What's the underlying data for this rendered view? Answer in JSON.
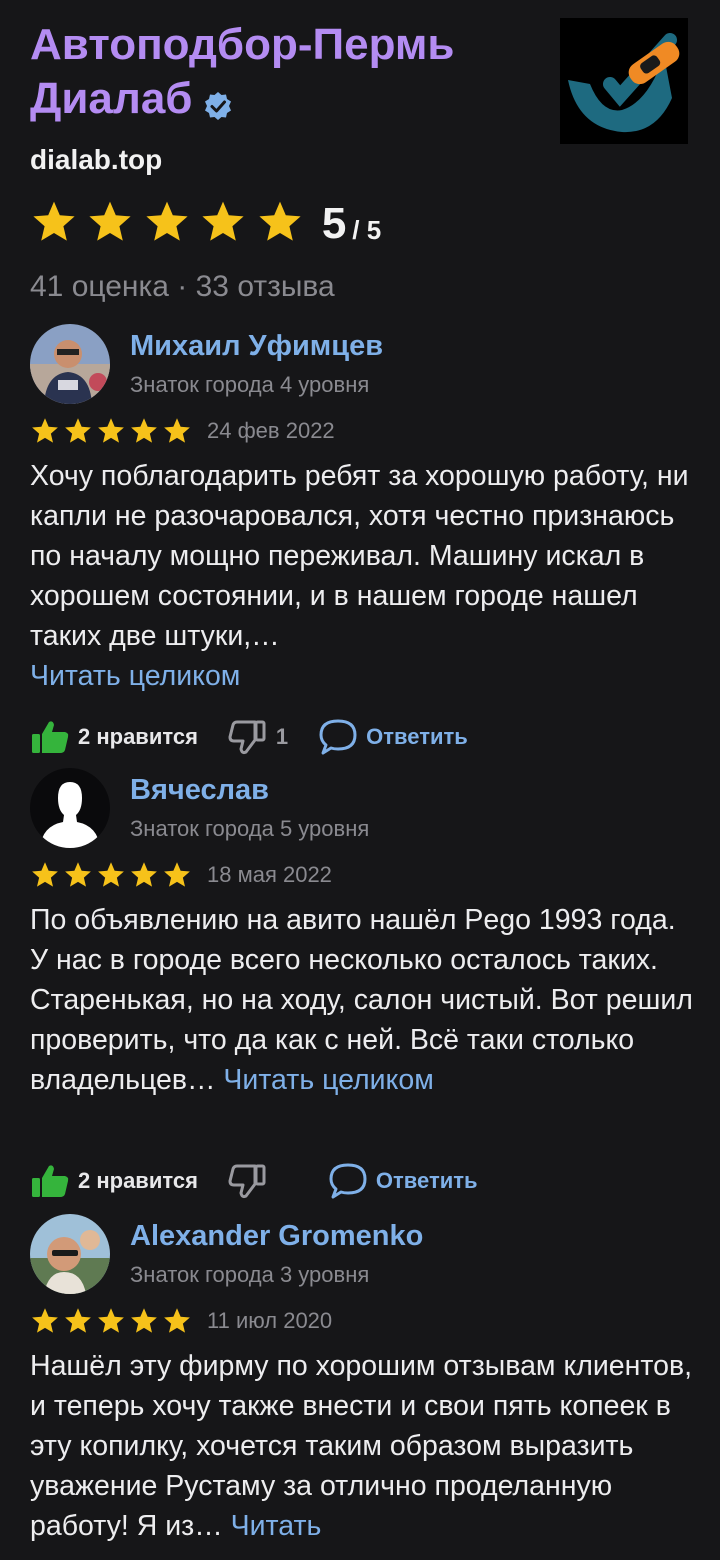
{
  "business": {
    "name_line1": "Автоподбор-Пермь",
    "name_line2": "Диалаб",
    "site": "dialab.top",
    "rating": "5",
    "rating_max": "/ 5",
    "counts": "41 оценка · 33 отзыва",
    "accent_color": "#b48cf2"
  },
  "reviews": [
    {
      "author": "Михаил Уфимцев",
      "level": "Знаток города 4 уровня",
      "stars": 5,
      "date": "24 фев 2022",
      "text": "Хочу поблагодарить ребят за хорошую работу, ни капли не разочаровался, хотя честно признаюсь по началу мощно переживал. Машину искал в хорошем состоянии, и в нашем городе нашел таких две штуки,…",
      "read_more": "Читать целиком",
      "likes": "2 нравится",
      "dislikes": "1",
      "reply": "Ответить"
    },
    {
      "author": "Вячеслав",
      "level": "Знаток города 5 уровня",
      "stars": 5,
      "date": "18 мая 2022",
      "text": "По объявлению на авито нашёл Pego 1993 года. У нас в городе всего несколько осталось таких. Старенькая, но на ходу, салон чистый. Вот решил проверить, что да как с ней. Всё таки столько владельцев…",
      "read_more": "Читать целиком",
      "likes": "2 нравится",
      "dislikes": "",
      "reply": "Ответить"
    },
    {
      "author": "Alexander Gromenko",
      "level": "Знаток города 3 уровня",
      "stars": 5,
      "date": "11 июл 2020",
      "text": "Нашёл эту фирму по хорошим отзывам клиентов, и теперь хочу также внести и свои пять копеек в эту копилку, хочется таким образом выразить уважение Рустаму за отлично проделанную работу! Я из…",
      "read_more": "Читать"
    }
  ],
  "icons": {
    "star": "star-icon",
    "verified": "verified-check-icon",
    "like": "thumbs-up-icon",
    "dislike": "thumbs-down-icon",
    "reply": "speech-bubble-icon"
  },
  "colors": {
    "background": "#161618",
    "star": "#f6c21a",
    "link": "#7fb0e8",
    "like_green": "#35b43c",
    "muted": "#8a8a90"
  }
}
